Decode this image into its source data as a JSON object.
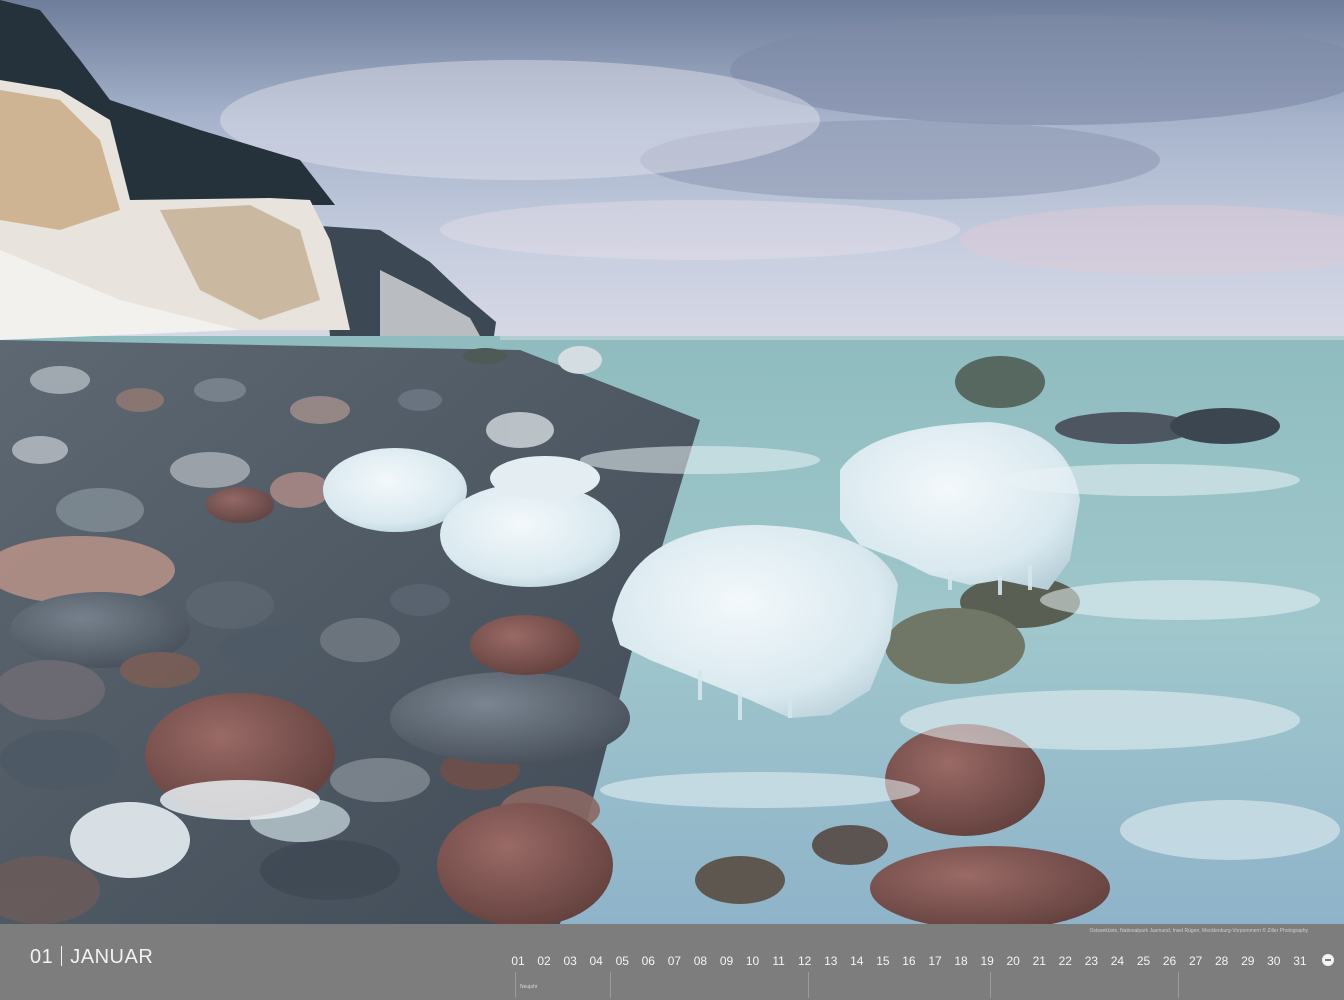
{
  "calendar": {
    "month_number": "01",
    "month_name": "JANUAR",
    "days": [
      "01",
      "02",
      "03",
      "04",
      "05",
      "06",
      "07",
      "08",
      "09",
      "10",
      "11",
      "12",
      "13",
      "14",
      "15",
      "16",
      "17",
      "18",
      "19",
      "20",
      "21",
      "22",
      "23",
      "24",
      "25",
      "26",
      "27",
      "28",
      "29",
      "30",
      "31"
    ],
    "credit": "Ostseeküste, Nationalpark Jasmund, Insel Rügen, Mecklenburg-Vorpommern © Ziller Photography",
    "note": "Neujahr"
  },
  "photo": {
    "sky_color": "#a6b3cb",
    "water_color": "#9fc7cc",
    "cliff_color": "#e8e3dc",
    "forest_color": "#23313a",
    "ice_color": "#e6f1f6",
    "rock_colors": [
      "#6c4b47",
      "#5f6670",
      "#7e5550",
      "#495561"
    ]
  }
}
